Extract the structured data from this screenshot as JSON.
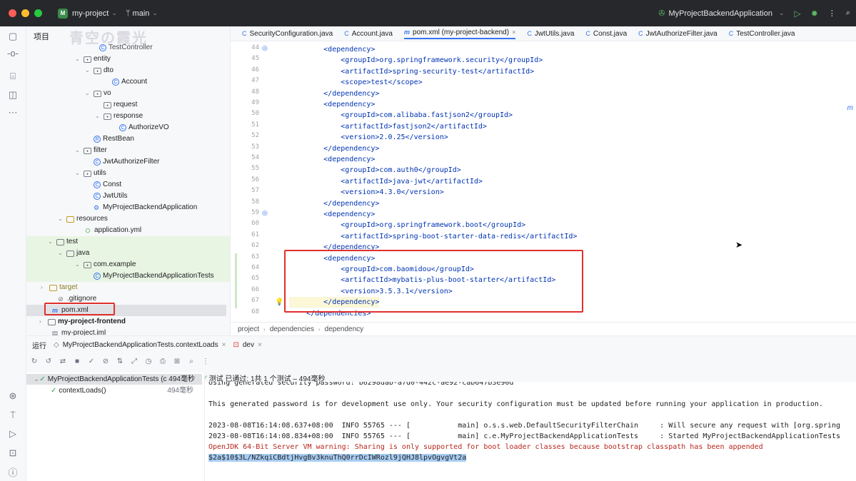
{
  "titlebar": {
    "project": "my-project",
    "project_badge": "M",
    "branch": "main",
    "run_config": "MyProjectBackendApplication"
  },
  "project_panel": {
    "title": "项目",
    "watermark": "青空の霞光",
    "items": [
      {
        "label": "TestController",
        "kind": "class"
      },
      {
        "label": "entity",
        "kind": "pkg",
        "expanded": true
      },
      {
        "label": "dto",
        "kind": "pkg",
        "expanded": true
      },
      {
        "label": "Account",
        "kind": "class"
      },
      {
        "label": "vo",
        "kind": "pkg",
        "expanded": true
      },
      {
        "label": "request",
        "kind": "pkg"
      },
      {
        "label": "response",
        "kind": "pkg",
        "expanded": true
      },
      {
        "label": "AuthorizeVO",
        "kind": "class"
      },
      {
        "label": "RestBean",
        "kind": "record"
      },
      {
        "label": "filter",
        "kind": "pkg",
        "expanded": true
      },
      {
        "label": "JwtAuthorizeFilter",
        "kind": "class"
      },
      {
        "label": "utils",
        "kind": "pkg",
        "expanded": true
      },
      {
        "label": "Const",
        "kind": "class"
      },
      {
        "label": "JwtUtils",
        "kind": "class"
      },
      {
        "label": "MyProjectBackendApplication",
        "kind": "app"
      },
      {
        "label": "resources",
        "kind": "folder",
        "expanded": true
      },
      {
        "label": "application.yml",
        "kind": "yml"
      },
      {
        "label": "test",
        "kind": "folder",
        "expanded": true
      },
      {
        "label": "java",
        "kind": "folder",
        "expanded": true
      },
      {
        "label": "com.example",
        "kind": "pkg",
        "expanded": true
      },
      {
        "label": "MyProjectBackendApplicationTests",
        "kind": "class"
      },
      {
        "label": "target",
        "kind": "folder"
      },
      {
        "label": ".gitignore",
        "kind": "git"
      },
      {
        "label": "pom.xml",
        "kind": "maven"
      },
      {
        "label": "my-project-frontend",
        "kind": "folder"
      },
      {
        "label": "my-project.iml",
        "kind": "file"
      }
    ]
  },
  "tabs": [
    {
      "label": "SecurityConfiguration.java",
      "icon": "C"
    },
    {
      "label": "Account.java",
      "icon": "C"
    },
    {
      "label": "pom.xml (my-project-backend)",
      "icon": "m",
      "active": true
    },
    {
      "label": "JwtUtils.java",
      "icon": "C"
    },
    {
      "label": "Const.java",
      "icon": "C"
    },
    {
      "label": "JwtAuthorizeFilter.java",
      "icon": "C"
    },
    {
      "label": "TestController.java",
      "icon": "C"
    }
  ],
  "editor": {
    "lines": [
      {
        "num": "44",
        "code": "        <dependency>"
      },
      {
        "num": "45",
        "code": "            <groupId>org.springframework.security</groupId>"
      },
      {
        "num": "46",
        "code": "            <artifactId>spring-security-test</artifactId>"
      },
      {
        "num": "47",
        "code": "            <scope>test</scope>"
      },
      {
        "num": "48",
        "code": "        </dependency>"
      },
      {
        "num": "49",
        "code": "        <dependency>"
      },
      {
        "num": "50",
        "code": "            <groupId>com.alibaba.fastjson2</groupId>"
      },
      {
        "num": "51",
        "code": "            <artifactId>fastjson2</artifactId>"
      },
      {
        "num": "52",
        "code": "            <version>2.0.25</version>"
      },
      {
        "num": "53",
        "code": "        </dependency>"
      },
      {
        "num": "54",
        "code": "        <dependency>"
      },
      {
        "num": "55",
        "code": "            <groupId>com.auth0</groupId>"
      },
      {
        "num": "56",
        "code": "            <artifactId>java-jwt</artifactId>"
      },
      {
        "num": "57",
        "code": "            <version>4.3.0</version>"
      },
      {
        "num": "58",
        "code": "        </dependency>"
      },
      {
        "num": "59",
        "code": "        <dependency>"
      },
      {
        "num": "60",
        "code": "            <groupId>org.springframework.boot</groupId>"
      },
      {
        "num": "61",
        "code": "            <artifactId>spring-boot-starter-data-redis</artifactId>"
      },
      {
        "num": "62",
        "code": "        </dependency>"
      },
      {
        "num": "63",
        "code": "        <dependency>"
      },
      {
        "num": "64",
        "code": "            <groupId>com.baomidou</groupId>"
      },
      {
        "num": "65",
        "code": "            <artifactId>mybatis-plus-boot-starter</artifactId>"
      },
      {
        "num": "66",
        "code": "            <version>3.5.3.1</version>"
      },
      {
        "num": "67",
        "code": "        </dependency>"
      },
      {
        "num": "68",
        "code": "    </dependencies>"
      }
    ],
    "right_hint": "m"
  },
  "breadcrumb": [
    "project",
    "dependencies",
    "dependency"
  ],
  "run_panel": {
    "title": "运行",
    "run_tab": "MyProjectBackendApplicationTests.contextLoads",
    "dev_tab": "dev",
    "status_prefix": "测试 已通过:",
    "status_detail": "1共 1 个测试 – 494毫秒",
    "tests": [
      {
        "label": "MyProjectBackendApplicationTests (c 494毫秒",
        "time": ""
      },
      {
        "label": "contextLoads()",
        "time": "494毫秒"
      }
    ],
    "console": [
      {
        "text": "Using generated security password: b6298dab-a7d0-442c-ae92-cab647b3e90d",
        "kind": "normal"
      },
      {
        "text": "",
        "kind": "normal"
      },
      {
        "text": "This generated password is for development use only. Your security configuration must be updated before running your application in production.",
        "kind": "normal"
      },
      {
        "text": "",
        "kind": "normal"
      },
      {
        "text": "2023-08-08T16:14:08.637+08:00  INFO 55765 --- [           main] o.s.s.web.DefaultSecurityFilterChain     : Will secure any request with [org.spring",
        "kind": "normal"
      },
      {
        "text": "2023-08-08T16:14:08.834+08:00  INFO 55765 --- [           main] c.e.MyProjectBackendApplicationTests     : Started MyProjectBackendApplicationTests",
        "kind": "normal"
      },
      {
        "text": "OpenJDK 64-Bit Server VM warning: Sharing is only supported for boot loader classes because bootstrap classpath has been appended",
        "kind": "warn"
      },
      {
        "text": "$2a$10$3L/NZkqiCBdtjHvgBv3knuThQ0rrDcIWRozl9jQHJ8lpvOgvgVt2a",
        "kind": "sel"
      }
    ]
  }
}
